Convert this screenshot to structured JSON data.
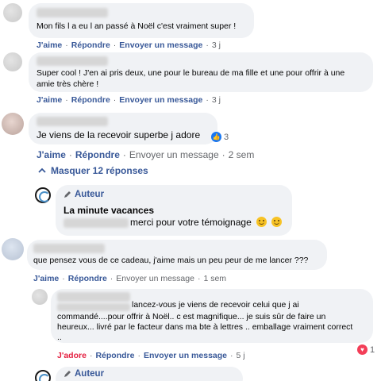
{
  "comments": [
    {
      "text": "Mon fils l a eu l an passé à Noël c'est vraiment super !",
      "like": "J'aime",
      "reply": "Répondre",
      "message": "Envoyer un message",
      "time": "3 j"
    },
    {
      "text_line1": "Super cool ! J'en ai pris deux, une pour le bureau de ma fille et une pour offrir à une",
      "text_line2": "amie très chère !",
      "like": "J'aime",
      "reply": "Répondre",
      "message": "Envoyer un message",
      "time": "3 j"
    },
    {
      "text": "Je viens de la recevoir superbe j adore",
      "reactions_count": "3",
      "like": "J'aime",
      "reply": "Répondre",
      "message": "Envoyer un message",
      "time": "2 sem",
      "hide_replies": "Masquer 12 réponses"
    },
    {
      "author_badge": "Auteur",
      "page_name": "La minute vacances",
      "text": "merci pour votre témoignage"
    },
    {
      "text": "que pensez vous de ce cadeau, j'aime mais un peu peur de me lancer ???",
      "like": "J'aime",
      "reply": "Répondre",
      "message": "Envoyer un message",
      "time": "1 sem"
    },
    {
      "text_line1": "lancez-vous je viens de recevoir celui que j ai",
      "text_line2": "commandé....pour offrir à Noël.. c est magnifique... je suis sûr de faire un",
      "text_line3": "heureux... livré par le facteur dans ma bte à lettres .. emballage vraiment correct",
      "text_line4": "..",
      "reactions_count": "1",
      "like": "J'adore",
      "reply": "Répondre",
      "message": "Envoyer un message",
      "time": "5 j"
    },
    {
      "author_badge": "Auteur"
    }
  ],
  "colors": {
    "link": "#385898",
    "meta": "#65676b",
    "bubble": "#f0f2f5",
    "love": "#e41e3f",
    "like_icon": "#1877f2"
  },
  "icons": [
    "pencil-icon",
    "chevron-up-icon",
    "like-reaction-icon",
    "love-reaction-icon",
    "smiley-emoji-icon"
  ]
}
